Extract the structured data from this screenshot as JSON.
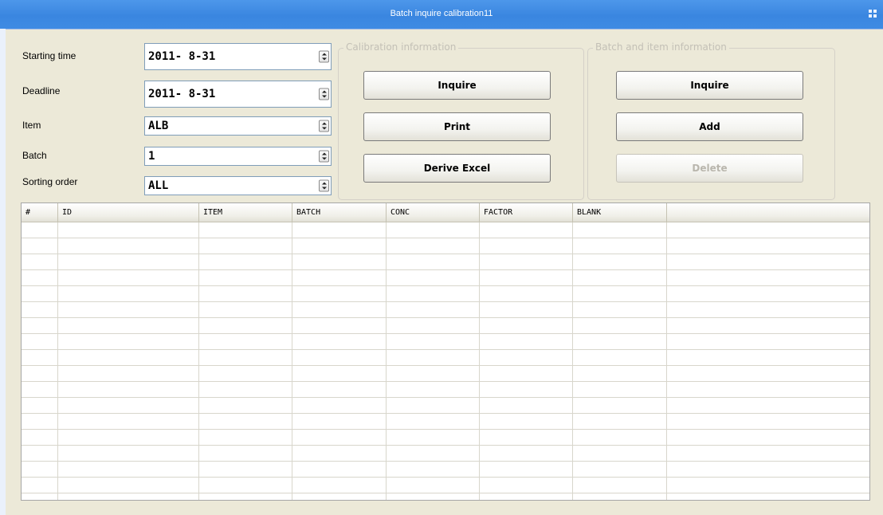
{
  "window": {
    "title": "Batch inquire calibration11"
  },
  "filters": {
    "starting_time": {
      "label": "Starting time",
      "value": "2011- 8-31"
    },
    "deadline": {
      "label": "Deadline",
      "value": "2011- 8-31"
    },
    "item": {
      "label": "Item",
      "value": "ALB"
    },
    "batch": {
      "label": "Batch",
      "value": "1"
    },
    "sorting_order": {
      "label": "Sorting order",
      "value": "ALL"
    }
  },
  "calibration_group": {
    "title": "Calibration information",
    "buttons": {
      "inquire": "Inquire",
      "print": "Print",
      "derive_excel": "Derive Excel"
    }
  },
  "batch_item_group": {
    "title": "Batch and item information",
    "buttons": {
      "inquire": "Inquire",
      "add": "Add",
      "delete": "Delete"
    },
    "delete_enabled": false
  },
  "table": {
    "columns": [
      "#",
      "ID",
      "ITEM",
      "BATCH",
      "CONC",
      "FACTOR",
      "BLANK",
      ""
    ],
    "row_count": 17,
    "rows": []
  },
  "colors": {
    "titlebar": "#3a86e0",
    "background": "#ece9d8",
    "disabled_text": "#b9b6ad"
  }
}
